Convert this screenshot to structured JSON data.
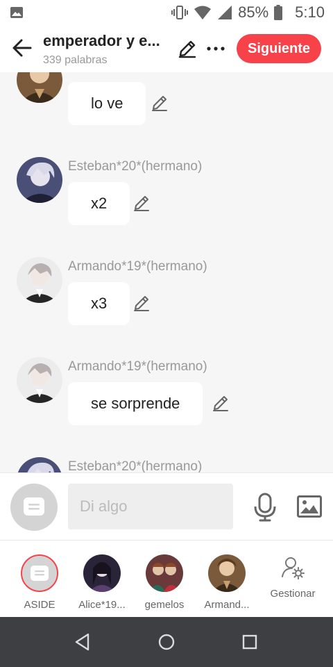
{
  "status_bar": {
    "battery": "85%",
    "time": "5:10"
  },
  "header": {
    "title": "emperador y e...",
    "subtitle": "339 palabras",
    "next_label": "Siguiente"
  },
  "messages": [
    {
      "name": "",
      "text": "lo ve"
    },
    {
      "name": "Esteban*20*(hermano)",
      "text": "x2"
    },
    {
      "name": "Armando*19*(hermano)",
      "text": "x3"
    },
    {
      "name": "Armando*19*(hermano)",
      "text": "se sorprende"
    },
    {
      "name": "Esteban*20*(hermano)",
      "text": ""
    }
  ],
  "composer": {
    "placeholder": "Di algo"
  },
  "characters": [
    {
      "label": "ASIDE"
    },
    {
      "label": "Alice*19..."
    },
    {
      "label": "gemelos"
    },
    {
      "label": "Armand..."
    },
    {
      "label": "Gestionar"
    }
  ],
  "colors": {
    "accent": "#f7424a",
    "background": "#f6f6f6",
    "navbar": "#3d3f42"
  }
}
